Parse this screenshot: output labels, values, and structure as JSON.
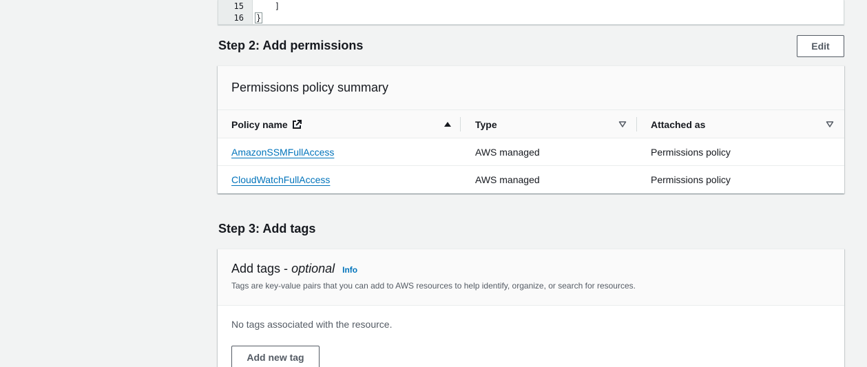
{
  "code_editor": {
    "lines": [
      {
        "number": "15",
        "text": "    ]"
      },
      {
        "number": "16",
        "text": "}"
      }
    ]
  },
  "step2": {
    "title": "Step 2: Add permissions",
    "edit_label": "Edit",
    "panel_title": "Permissions policy summary",
    "columns": {
      "policy_name": "Policy name",
      "type": "Type",
      "attached_as": "Attached as"
    },
    "rows": [
      {
        "policy_name": "AmazonSSMFullAccess",
        "type": "AWS managed",
        "attached_as": "Permissions policy"
      },
      {
        "policy_name": "CloudWatchFullAccess",
        "type": "AWS managed",
        "attached_as": "Permissions policy"
      }
    ],
    "icons": {
      "external_link": "external-link-icon",
      "sort_asc": "caret-up-filled-icon",
      "sort_desc": "caret-down-outline-icon"
    }
  },
  "step3": {
    "title": "Step 3: Add tags",
    "panel_title": "Add tags -",
    "panel_title_optional": "optional",
    "info_label": "Info",
    "description": "Tags are key-value pairs that you can add to AWS resources to help identify, organize, or search for resources.",
    "empty_text": "No tags associated with the resource.",
    "add_tag_label": "Add new tag"
  },
  "colors": {
    "page_bg": "#f2f3f3",
    "link": "#0073bb",
    "text": "#16191f",
    "secondary_text": "#545b64"
  }
}
